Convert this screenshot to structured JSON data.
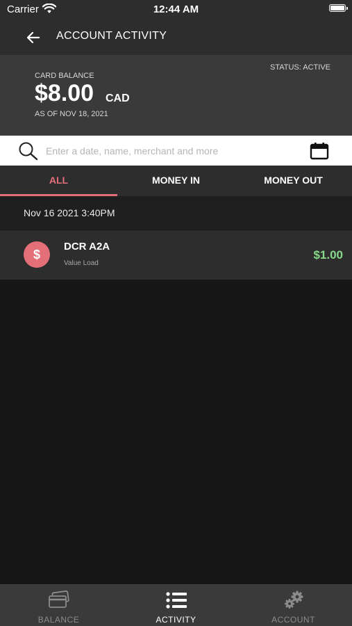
{
  "status_bar": {
    "carrier": "Carrier",
    "time": "12:44 AM"
  },
  "header": {
    "title": "ACCOUNT ACTIVITY",
    "back_icon": "arrow-left-icon"
  },
  "balance": {
    "label": "CARD BALANCE",
    "amount": "$8.00",
    "currency": "CAD",
    "as_of": "AS OF NOV 18, 2021",
    "status": "STATUS: ACTIVE"
  },
  "search": {
    "placeholder": "Enter a date, name, merchant and more",
    "value": ""
  },
  "tabs": [
    {
      "label": "ALL",
      "active": true
    },
    {
      "label": "MONEY IN",
      "active": false
    },
    {
      "label": "MONEY OUT",
      "active": false
    }
  ],
  "transactions": {
    "date_header": "Nov 16 2021  3:40PM",
    "items": [
      {
        "icon_symbol": "$",
        "name": "DCR A2A",
        "type": "Value Load",
        "amount": "$1.00"
      }
    ]
  },
  "bottom_nav": [
    {
      "label": "BALANCE",
      "icon": "card-icon",
      "active": false
    },
    {
      "label": "ACTIVITY",
      "icon": "list-icon",
      "active": true
    },
    {
      "label": "ACCOUNT",
      "icon": "gear-icon",
      "active": false
    }
  ],
  "colors": {
    "accent": "#e36f79",
    "positive": "#86d98a",
    "background": "#171717",
    "surface": "#2d2d2d"
  }
}
